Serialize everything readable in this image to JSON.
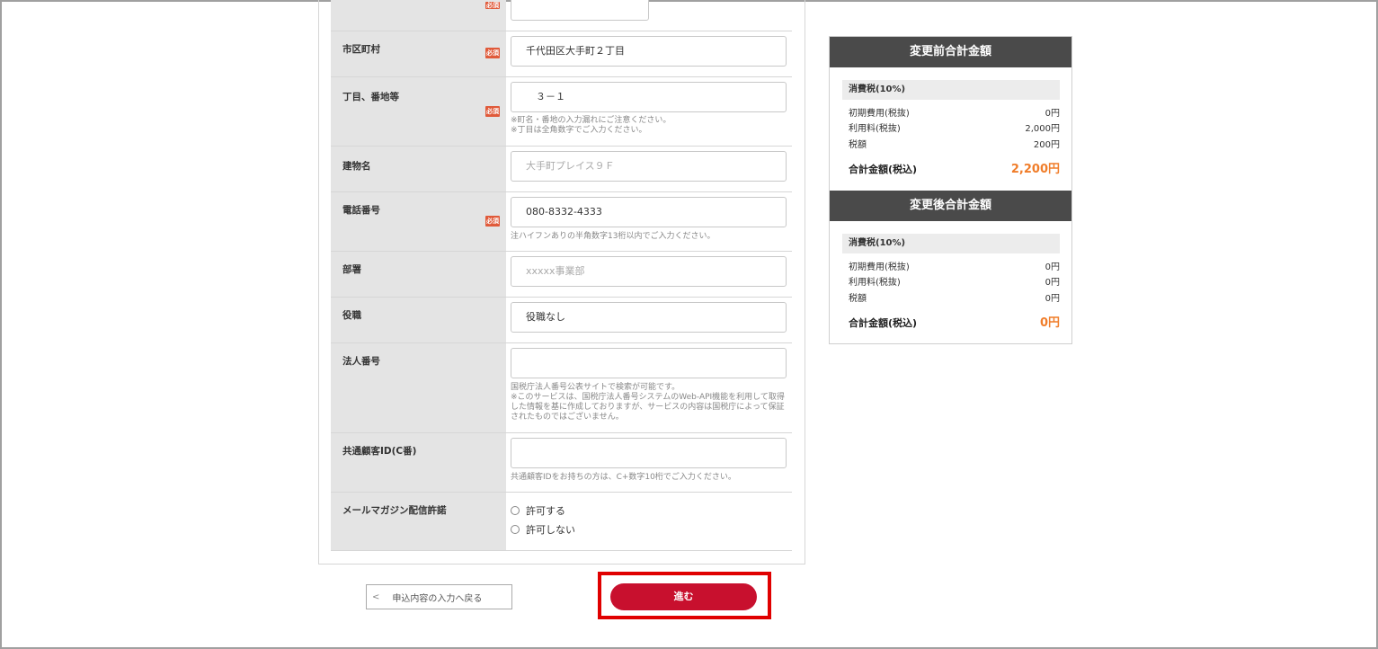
{
  "required_badge": "必須",
  "form": {
    "city": {
      "label": "市区町村",
      "value": "千代田区大手町２丁目"
    },
    "chome": {
      "label": "丁目、番地等",
      "value": "　３－１",
      "note": "※町名・番地の入力漏れにご注意ください。\n※丁目は全角数字でご入力ください。"
    },
    "building": {
      "label": "建物名",
      "placeholder": "大手町プレイス９Ｆ"
    },
    "phone": {
      "label": "電話番号",
      "value": "080-8332-4333",
      "note": "注ハイフンありの半角数字13桁以内でご入力ください。"
    },
    "department": {
      "label": "部署",
      "placeholder": "xxxxx事業部"
    },
    "position": {
      "label": "役職",
      "value": "役職なし"
    },
    "corp_number": {
      "label": "法人番号",
      "value": "",
      "note": "国税庁法人番号公表サイトで検索が可能です。\n※このサービスは、国税庁法人番号システムのWeb-API機能を利用して取得した情報を基に作成しておりますが、サービスの内容は国税庁によって保証されたものではございません。"
    },
    "customer_id": {
      "label": "共通顧客ID(C番)",
      "value": "",
      "note": "共通顧客IDをお持ちの方は、C+数字10桁でご入力ください。"
    },
    "newsletter": {
      "label": "メールマガジン配信許諾",
      "options": [
        "許可する",
        "許可しない"
      ]
    }
  },
  "buttons": {
    "back": "申込内容の入力へ戻る",
    "next": "進む"
  },
  "summary_before": {
    "title": "変更前合計金額",
    "tax_label": "消費税(10%)",
    "lines": [
      {
        "label": "初期費用(税抜)",
        "value": "0円"
      },
      {
        "label": "利用料(税抜)",
        "value": "2,000円"
      },
      {
        "label": "税額",
        "value": "200円"
      }
    ],
    "total_label": "合計金額(税込)",
    "total_value": "2,200円"
  },
  "summary_after": {
    "title": "変更後合計金額",
    "tax_label": "消費税(10%)",
    "lines": [
      {
        "label": "初期費用(税抜)",
        "value": "0円"
      },
      {
        "label": "利用料(税抜)",
        "value": "0円"
      },
      {
        "label": "税額",
        "value": "0円"
      }
    ],
    "total_label": "合計金額(税込)",
    "total_value": "0円"
  },
  "colors": {
    "accent": "#c8102e",
    "highlight": "#e00000",
    "total": "#f07d2a",
    "header": "#4a4a4a"
  }
}
